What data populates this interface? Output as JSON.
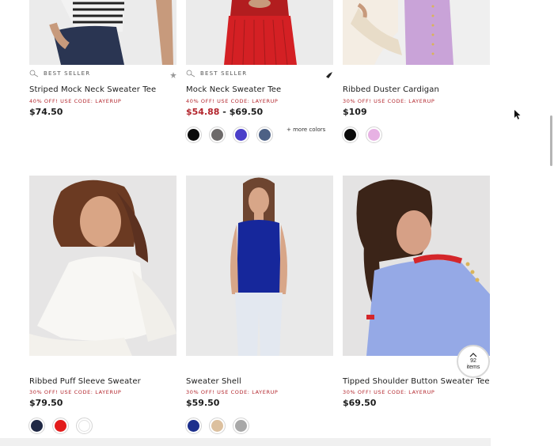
{
  "products_row1": [
    {
      "badge": "BEST SELLER",
      "title": "Striped Mock Neck Sweater Tee",
      "promo": "40% OFF! USE CODE: LAYERUP",
      "price": "$74.50",
      "sale_price": "",
      "price_sep": "",
      "swatches": []
    },
    {
      "badge": "BEST SELLER",
      "title": "Mock Neck Sweater Tee",
      "promo": "40% OFF! USE CODE: LAYERUP",
      "price": "$69.50",
      "sale_price": "$54.88",
      "price_sep": " - ",
      "swatches": [
        "#0b0b0b",
        "#6d6a6a",
        "#4b3fc9",
        "#4d6185"
      ],
      "more_colors": "+ more colors"
    },
    {
      "badge": "",
      "title": "Ribbed Duster Cardigan",
      "promo": "30% OFF! USE CODE: LAYERUP",
      "price": "$109",
      "sale_price": "",
      "price_sep": "",
      "swatches": [
        "#0b0b0b",
        "#e7b1e3"
      ]
    }
  ],
  "products_row2": [
    {
      "title": "Ribbed Puff Sleeve Sweater",
      "promo": "30% OFF! USE CODE: LAYERUP",
      "price": "$79.50",
      "swatches": [
        "#1f2844",
        "#e31c1c",
        "#ffffff"
      ]
    },
    {
      "title": "Sweater Shell",
      "promo": "30% OFF! USE CODE: LAYERUP",
      "price": "$59.50",
      "swatches": [
        "#1c2f8c",
        "#dcc09e",
        "#a8a8a8"
      ]
    },
    {
      "title": "Tipped Shoulder Button Sweater Tee",
      "promo": "30% OFF! USE CODE: LAYERUP",
      "price": "$69.50",
      "swatches": []
    }
  ],
  "scroll_top": {
    "count": "92",
    "label": "items"
  },
  "colors": {
    "promo": "#b3262d",
    "sale": "#b3262d"
  }
}
